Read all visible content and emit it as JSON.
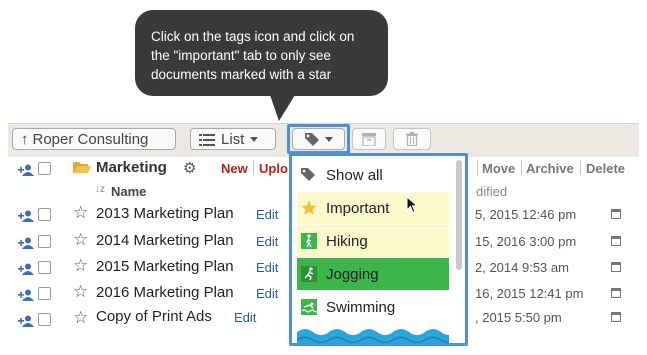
{
  "tooltip": {
    "line1": "Click on the tags icon and click on",
    "line2": "the \"important\" tab to only see",
    "line3": "documents marked with a star"
  },
  "toolbar": {
    "back_label": "Roper Consulting",
    "view_label": "List"
  },
  "folder": {
    "name": "Marketing",
    "actions": [
      "New",
      "Uplo",
      "Move",
      "Archive",
      "Delete"
    ],
    "sort_label": "Name",
    "modified_fragment": "dified"
  },
  "documents": [
    {
      "title": "2013 Marketing Plan",
      "edit": "Edit",
      "date": "5, 2015 12:46 pm"
    },
    {
      "title": "2014 Marketing Plan",
      "edit": "Edit",
      "date": "15, 2016 3:00 pm"
    },
    {
      "title": "2015 Marketing Plan",
      "edit": "Edit",
      "date": "2, 2014 9:53 am"
    },
    {
      "title": "2016 Marketing Plan",
      "edit": "Edit",
      "date": "16, 2015 12:41 pm"
    },
    {
      "title": "Copy of Print Ads",
      "edit": "Edit",
      "date": ", 2015 5:50 pm"
    }
  ],
  "tag_menu": {
    "items": [
      {
        "label": "Show all",
        "icon": "tags-icon",
        "bg": "#ffffff"
      },
      {
        "label": "Important",
        "icon": "star-icon",
        "bg": "#fbf8cc"
      },
      {
        "label": "Hiking",
        "icon": "hiking-icon",
        "bg": "#fbf8cc"
      },
      {
        "label": "Jogging",
        "icon": "jogging-icon",
        "bg": "#3cb54a"
      },
      {
        "label": "Swimming",
        "icon": "swimming-icon",
        "bg": "#ffffff"
      }
    ]
  },
  "colors": {
    "accent_blue": "#4d8fd9",
    "action_red": "#b32020",
    "tooltip_bg": "#3a3a3a",
    "jogging_green": "#3cb54a",
    "highlight_yellow": "#fbf8cc"
  }
}
